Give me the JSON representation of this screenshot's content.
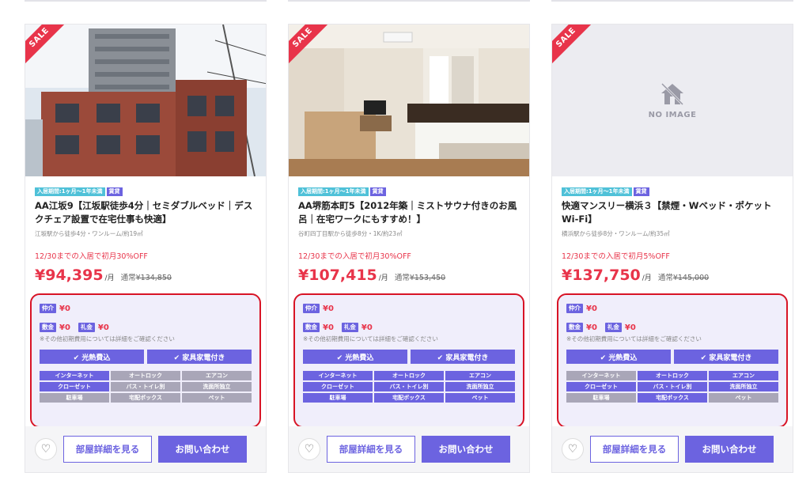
{
  "common": {
    "sale_badge": "SALE",
    "per_month": "/月",
    "normal_label": "通常",
    "note": "※その他初期費用については詳細をご確認ください",
    "features": [
      "✔ 光熱費込",
      "✔ 家具家電付き"
    ],
    "detail_button": "部屋詳細を見る",
    "contact_button": "お問い合わせ",
    "no_image": "NO IMAGE",
    "fee_labels": {
      "brokerage": "仲介",
      "deposit": "敷金",
      "key_money": "礼金"
    },
    "amenity_labels": [
      "インターネット",
      "オートロック",
      "エアコン",
      "クローゼット",
      "バス・トイレ別",
      "洗面所独立",
      "駐車場",
      "宅配ボックス",
      "ペット"
    ]
  },
  "listings": [
    {
      "period_tag": "入居期間:1ヶ月〜1年未満",
      "type_tag": "賃貸",
      "title": "AA江坂9【江坂駅徒歩4分｜セミダブルベッド｜デスクチェア設置で在宅仕事も快適】",
      "access": "江坂駅から徒歩4分・ワンルーム/約19㎡",
      "campaign": "12/30までの入居で初月30%OFF",
      "price": "¥94,395",
      "normal_price": "¥134,850",
      "fees": {
        "brokerage": "¥0",
        "deposit": "¥0",
        "key_money": "¥0"
      },
      "amenities_on": [
        true,
        false,
        false,
        true,
        false,
        false,
        false,
        false,
        false
      ],
      "photo": "building-exterior"
    },
    {
      "period_tag": "入居期間:1ヶ月〜1年未満",
      "type_tag": "賃貸",
      "title": "AA堺筋本町5【2012年築｜ミストサウナ付きのお風呂｜在宅ワークにもすすめ！】",
      "access": "谷町四丁目駅から徒歩8分・1K/約23㎡",
      "campaign": "12/30までの入居で初月30%OFF",
      "price": "¥107,415",
      "normal_price": "¥153,450",
      "fees": {
        "brokerage": "¥0",
        "deposit": "¥0",
        "key_money": "¥0"
      },
      "amenities_on": [
        true,
        true,
        true,
        true,
        true,
        true,
        true,
        true,
        true
      ],
      "photo": "room-interior"
    },
    {
      "period_tag": "入居期間:1ヶ月〜1年未満",
      "type_tag": "賃貸",
      "title": "快適マンスリー横浜３【禁煙・Wベッド・ポケットWi-Fi】",
      "access": "横浜駅から徒歩8分・ワンルーム/約35㎡",
      "campaign": "12/30までの入居で初月5%OFF",
      "price": "¥137,750",
      "normal_price": "¥145,000",
      "fees": {
        "brokerage": "¥0",
        "deposit": "¥0",
        "key_money": "¥0"
      },
      "amenities_on": [
        false,
        true,
        true,
        true,
        true,
        true,
        false,
        true,
        false
      ],
      "photo": "no-image"
    }
  ],
  "colors": {
    "accent": "#6c63e0",
    "sale": "#e8344a",
    "highlight_border": "#d81426",
    "tag_period": "#4fc1d8"
  }
}
